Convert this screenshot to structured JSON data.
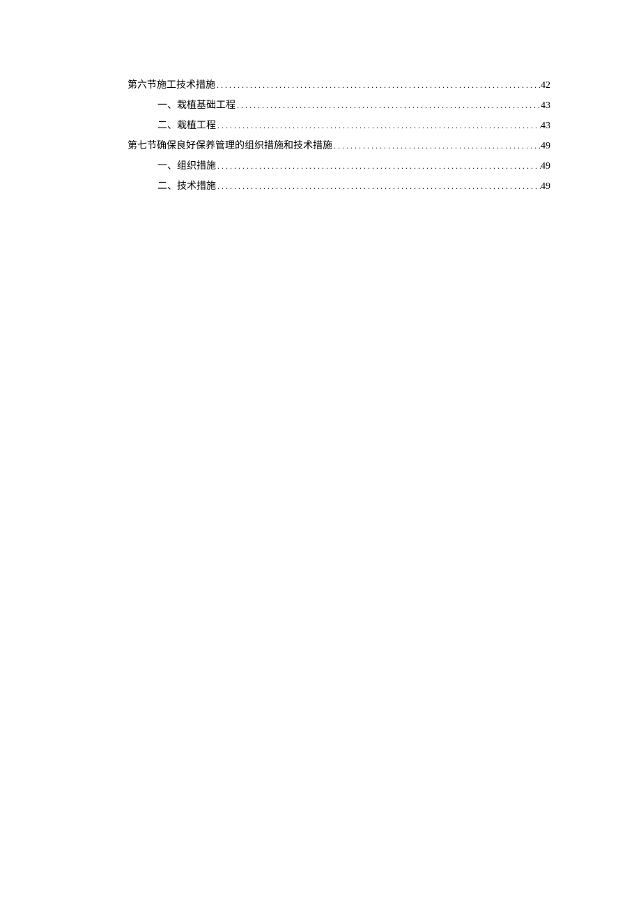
{
  "toc": {
    "entries": [
      {
        "title": "第六节施工技术措施",
        "page": "42",
        "indent": 0
      },
      {
        "title": "一、栽植基础工程",
        "page": "43",
        "indent": 1
      },
      {
        "title": "二、栽植工程",
        "page": "43",
        "indent": 1
      },
      {
        "title": "第七节确保良好保养管理的组织措施和技术措施",
        "page": "49",
        "indent": 0
      },
      {
        "title": "一、组织措施",
        "page": "49",
        "indent": 1
      },
      {
        "title": "二、技术措施",
        "page": "49",
        "indent": 1
      }
    ]
  }
}
